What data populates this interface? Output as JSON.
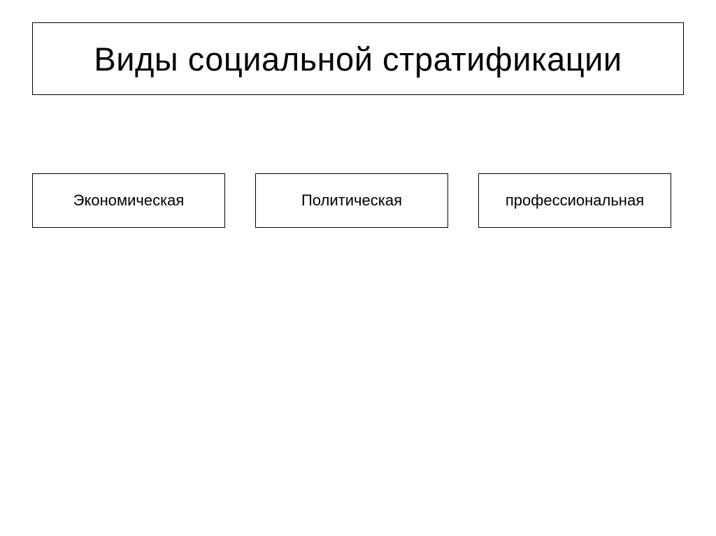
{
  "title": "Виды социальной стратификации",
  "categories": [
    {
      "label": "Экономическая"
    },
    {
      "label": "Политическая"
    },
    {
      "label": "профессиональная"
    }
  ]
}
